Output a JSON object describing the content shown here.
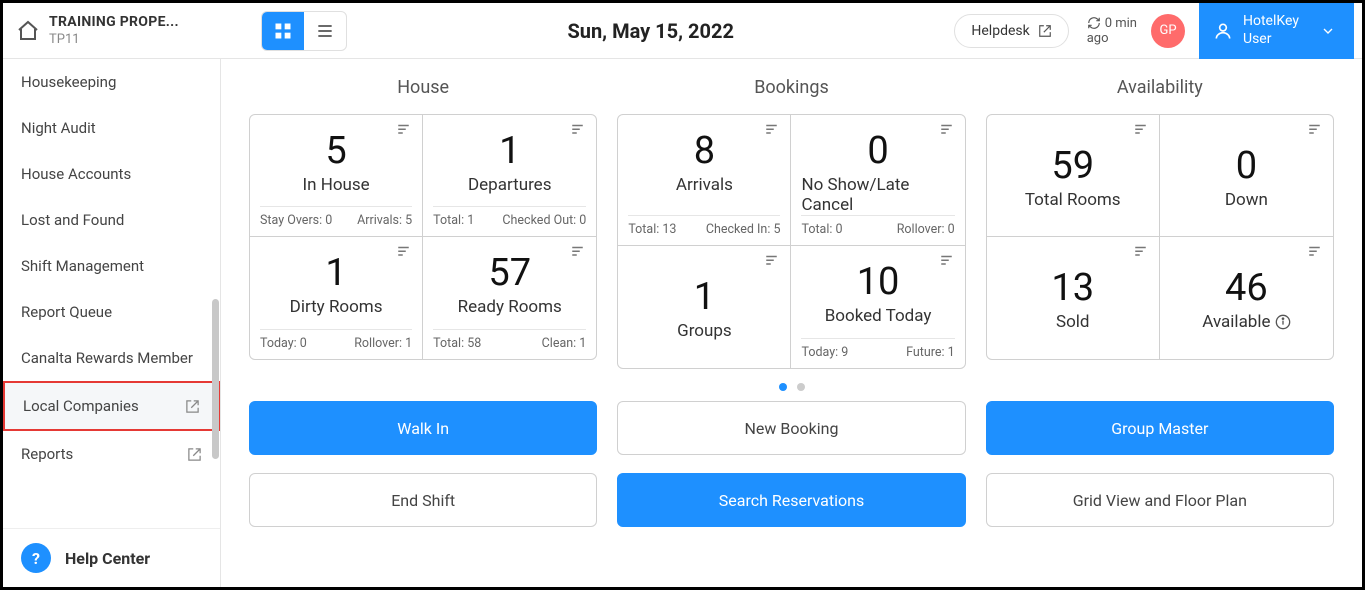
{
  "property": {
    "name": "TRAINING PROPE...",
    "code": "TP11"
  },
  "header": {
    "date": "Sun, May 15, 2022",
    "helpdesk": "Helpdesk",
    "sync_top": "0 min",
    "sync_bottom": "ago",
    "avatar": "GP",
    "user_line1": "HotelKey",
    "user_line2": "User"
  },
  "sidebar": {
    "items": [
      {
        "label": "Housekeeping"
      },
      {
        "label": "Night Audit"
      },
      {
        "label": "House Accounts"
      },
      {
        "label": "Lost and Found"
      },
      {
        "label": "Shift Management"
      },
      {
        "label": "Report Queue"
      },
      {
        "label": "Canalta Rewards Member"
      },
      {
        "label": "Local Companies",
        "external": true,
        "highlight": true
      },
      {
        "label": "Reports",
        "external": true
      }
    ],
    "help_center": "Help Center"
  },
  "sections": {
    "house": {
      "title": "House",
      "cards": [
        {
          "num": "5",
          "label": "In House",
          "left_k": "Stay Overs:",
          "left_v": "0",
          "right_k": "Arrivals:",
          "right_v": "5"
        },
        {
          "num": "1",
          "label": "Departures",
          "left_k": "Total:",
          "left_v": "1",
          "right_k": "Checked Out:",
          "right_v": "0"
        },
        {
          "num": "1",
          "label": "Dirty Rooms",
          "left_k": "Today:",
          "left_v": "0",
          "right_k": "Rollover:",
          "right_v": "1"
        },
        {
          "num": "57",
          "label": "Ready Rooms",
          "left_k": "Total:",
          "left_v": "58",
          "right_k": "Clean:",
          "right_v": "1"
        }
      ]
    },
    "bookings": {
      "title": "Bookings",
      "cards": [
        {
          "num": "8",
          "label": "Arrivals",
          "left_k": "Total:",
          "left_v": "13",
          "right_k": "Checked In:",
          "right_v": "5"
        },
        {
          "num": "0",
          "label": "No Show/Late Cancel",
          "left_k": "Total:",
          "left_v": "0",
          "right_k": "Rollover:",
          "right_v": "0"
        },
        {
          "num": "1",
          "label": "Groups"
        },
        {
          "num": "10",
          "label": "Booked Today",
          "left_k": "Today:",
          "left_v": "9",
          "right_k": "Future:",
          "right_v": "1"
        }
      ]
    },
    "availability": {
      "title": "Availability",
      "cards": [
        {
          "num": "59",
          "label": "Total Rooms"
        },
        {
          "num": "0",
          "label": "Down"
        },
        {
          "num": "13",
          "label": "Sold"
        },
        {
          "num": "46",
          "label": "Available",
          "info": true
        }
      ]
    }
  },
  "actions": {
    "row1": [
      {
        "label": "Walk In",
        "primary": true
      },
      {
        "label": "New Booking"
      },
      {
        "label": "Group Master",
        "primary": true
      }
    ],
    "row2": [
      {
        "label": "End Shift"
      },
      {
        "label": "Search Reservations",
        "primary": true
      },
      {
        "label": "Grid View and Floor Plan"
      }
    ]
  }
}
